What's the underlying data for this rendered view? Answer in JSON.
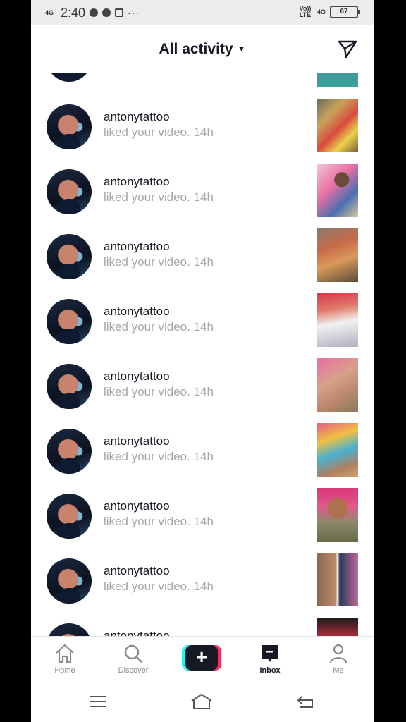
{
  "status_bar": {
    "network_label": "4G",
    "time": "2:40",
    "more": "···",
    "volte_label": "Vo)) LTE",
    "net_right": "4G",
    "battery": "67"
  },
  "header": {
    "title": "All activity"
  },
  "activity": [
    {
      "user": "antonytattoo",
      "text": "liked your video.",
      "time": "14h"
    },
    {
      "user": "antonytattoo",
      "text": "liked your video.",
      "time": "14h"
    },
    {
      "user": "antonytattoo",
      "text": "liked your video.",
      "time": "14h"
    },
    {
      "user": "antonytattoo",
      "text": "liked your video.",
      "time": "14h"
    },
    {
      "user": "antonytattoo",
      "text": "liked your video.",
      "time": "14h"
    },
    {
      "user": "antonytattoo",
      "text": "liked your video.",
      "time": "14h"
    },
    {
      "user": "antonytattoo",
      "text": "liked your video.",
      "time": "14h"
    },
    {
      "user": "antonytattoo",
      "text": "liked your video.",
      "time": "14h"
    },
    {
      "user": "antonytattoo",
      "text": "",
      "time": ""
    }
  ],
  "bottom_nav": {
    "home": "Home",
    "discover": "Discover",
    "inbox": "Inbox",
    "me": "Me"
  },
  "colors": {
    "accent_cyan": "#25f4ee",
    "accent_red": "#fe2c55",
    "text_primary": "#161823",
    "text_secondary": "#a6a7ab"
  }
}
